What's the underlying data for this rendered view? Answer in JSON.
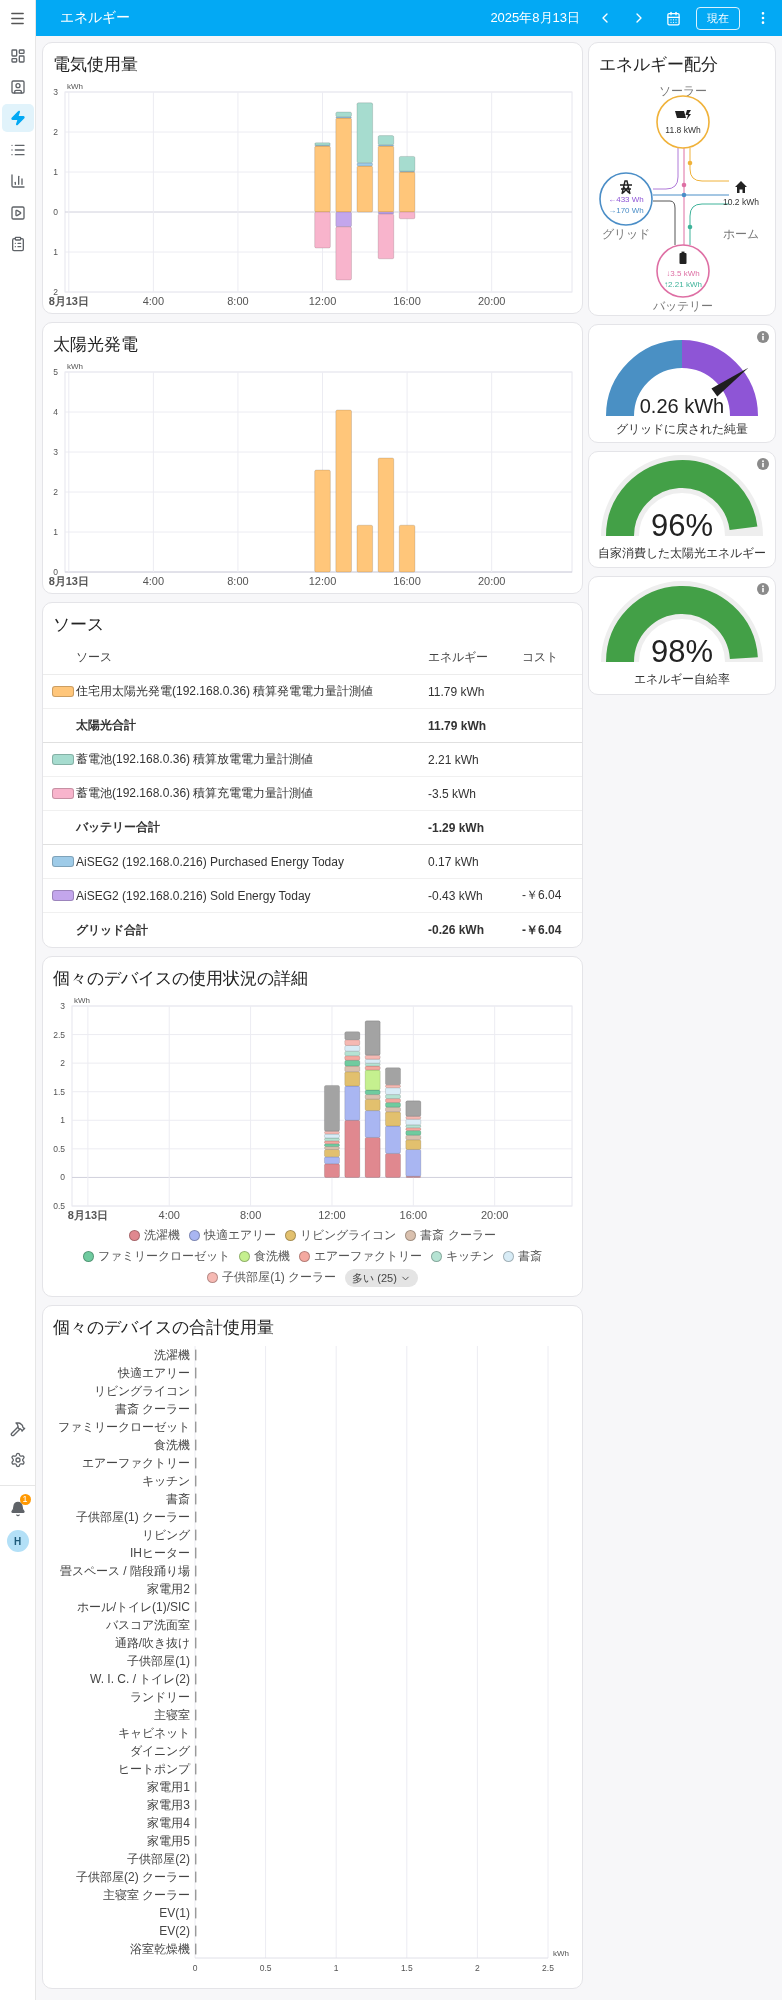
{
  "sidebar": {
    "items": [
      {
        "selected": false
      },
      {
        "selected": false
      },
      {
        "selected": true
      },
      {
        "selected": false
      },
      {
        "selected": false
      },
      {
        "selected": false
      },
      {
        "selected": false
      }
    ],
    "notification_badge": "1",
    "avatar": "H"
  },
  "top_bar": {
    "title": "エネルギー",
    "date": "2025年8月13日",
    "now_button": "現在"
  },
  "electricity_usage": {
    "title": "電気使用量",
    "chart_data": {
      "type": "bar",
      "grid": true,
      "stacked": true,
      "ylabel": "kWh",
      "x": [
        12,
        13,
        14,
        15,
        16
      ],
      "xlim": [
        -0.18,
        23.8
      ],
      "ylim": [
        -2,
        3
      ],
      "xticks": [
        {
          "value": 0,
          "label": "8月13日"
        },
        {
          "value": 4,
          "label": "4:00"
        },
        {
          "value": 8,
          "label": "8:00"
        },
        {
          "value": 12,
          "label": "12:00"
        },
        {
          "value": 16,
          "label": "16:00"
        },
        {
          "value": 20,
          "label": "20:00"
        }
      ],
      "yticks": [
        {
          "value": -2,
          "label": "2"
        },
        {
          "value": -1,
          "label": "1"
        },
        0,
        1,
        2,
        3
      ],
      "series": [
        {
          "color": "#ffc67a",
          "values": [
            1.65,
            2.35,
            1.15,
            1.65,
            1.0
          ]
        },
        {
          "color": "#9ecbe8",
          "values": [
            0.02,
            0.03,
            0.08,
            0.03,
            0.02
          ]
        },
        {
          "color": "#a6dccf",
          "values": [
            0.06,
            0.12,
            1.5,
            0.23,
            0.37
          ]
        },
        {
          "color": "#c3a6ec",
          "values": [
            null,
            -0.37,
            0,
            -0.05,
            0
          ]
        },
        {
          "color": "#f8b4cc",
          "values": [
            -0.9,
            -1.33,
            0,
            -1.12,
            -0.17
          ]
        }
      ]
    }
  },
  "solar_production": {
    "title": "太陽光発電",
    "chart_data": {
      "type": "bar",
      "grid": true,
      "ylabel": "kWh",
      "x": [
        12,
        13,
        14,
        15,
        16
      ],
      "xlim": [
        -0.18,
        23.8
      ],
      "ylim": [
        0,
        5
      ],
      "xticks": [
        {
          "value": 0,
          "label": "8月13日"
        },
        {
          "value": 4,
          "label": "4:00"
        },
        {
          "value": 8,
          "label": "8:00"
        },
        {
          "value": 12,
          "label": "12:00"
        },
        {
          "value": 16,
          "label": "16:00"
        },
        {
          "value": 20,
          "label": "20:00"
        }
      ],
      "yticks": [
        0,
        1,
        2,
        3,
        4,
        5
      ],
      "series": [
        {
          "color": "#ffc67a",
          "values": [
            2.55,
            4.05,
            1.17,
            2.85,
            1.17
          ]
        }
      ]
    }
  },
  "sources": {
    "title": "ソース",
    "columns": [
      "ソース",
      "エネルギー",
      "コスト"
    ],
    "rows": [
      {
        "kind": "source",
        "color": "#ffc67a",
        "name": "住宅用太陽光発電(192.168.0.36) 積算発電電力量計測値",
        "energy": "11.79 kWh"
      },
      {
        "kind": "total",
        "name": "太陽光合計",
        "energy": "11.79 kWh"
      },
      {
        "kind": "source",
        "color": "#a6dccf",
        "name": "蓄電池(192.168.0.36) 積算放電電力量計測値",
        "energy": "2.21 kWh"
      },
      {
        "kind": "source",
        "color": "#f8b4cc",
        "name": "蓄電池(192.168.0.36) 積算充電電力量計測値",
        "energy": "-3.5 kWh"
      },
      {
        "kind": "total",
        "name": "バッテリー合計",
        "energy": "-1.29 kWh"
      },
      {
        "kind": "source",
        "color": "#9ecbe8",
        "name": "AiSEG2 (192.168.0.216) Purchased Energy Today",
        "energy": "0.17 kWh"
      },
      {
        "kind": "source",
        "color": "#c3a6ec",
        "name": "AiSEG2 (192.168.0.216) Sold Energy Today",
        "energy": "-0.43 kWh",
        "cost": "-￥6.04"
      },
      {
        "kind": "total",
        "name": "グリッド合計",
        "energy": "-0.26 kWh",
        "cost": "-￥6.04"
      }
    ]
  },
  "device_usage_detail": {
    "title": "個々のデバイスの使用状況の詳細",
    "more_button": "多い (25)",
    "chart_data": {
      "type": "bar",
      "grid": true,
      "stacked": true,
      "ylabel": "kWh",
      "x": [
        12,
        13,
        14,
        15,
        16
      ],
      "xlim": [
        -0.78,
        23.8
      ],
      "ylim": [
        -0.5,
        3
      ],
      "xticks": [
        {
          "value": 0,
          "label": "8月13日"
        },
        {
          "value": 4,
          "label": "4:00"
        },
        {
          "value": 8,
          "label": "8:00"
        },
        {
          "value": 12,
          "label": "12:00"
        },
        {
          "value": 16,
          "label": "16:00"
        },
        {
          "value": 20,
          "label": "20:00"
        }
      ],
      "yticks": [
        {
          "value": -0.5,
          "label": "0.5"
        },
        0,
        0.5,
        1,
        1.5,
        2,
        2.5,
        3
      ],
      "series": [
        {
          "name": "洗濯機",
          "color": "#e0888f",
          "values": [
            0.24,
            1.0,
            0.7,
            0.42,
            0.02
          ]
        },
        {
          "name": "快適エアリー",
          "color": "#a9b6f2",
          "values": [
            0.12,
            0.6,
            0.47,
            0.48,
            0.47
          ]
        },
        {
          "name": "リビングライコン",
          "color": "#e2c06e",
          "values": [
            0.13,
            0.25,
            0.2,
            0.25,
            0.17
          ]
        },
        {
          "name": "書斎 クーラー",
          "color": "#d9c0ae",
          "values": [
            0.05,
            0.1,
            0.08,
            0.08,
            0.08
          ]
        },
        {
          "name": "ファミリークローゼット",
          "color": "#6fcb9f",
          "values": [
            0.05,
            0.1,
            0.08,
            0.08,
            0.08
          ]
        },
        {
          "name": "食洗機",
          "color": "#c5f08f",
          "values": [
            0,
            0,
            0.35,
            0,
            0
          ]
        },
        {
          "name": "エアーファクトリー",
          "color": "#f4a9a0",
          "values": [
            0.05,
            0.08,
            0.07,
            0.07,
            0.05
          ]
        },
        {
          "name": "キッチン",
          "color": "#b5e3d3",
          "values": [
            0.05,
            0.08,
            0.05,
            0.07,
            0.05
          ]
        },
        {
          "name": "書斎",
          "color": "#d8ecf6",
          "values": [
            0.07,
            0.1,
            0.07,
            0.12,
            0.1
          ]
        },
        {
          "name": "子供部屋(1) クーラー",
          "color": "#f6b9b3",
          "values": [
            0.05,
            0.1,
            0.07,
            0.05,
            0.05
          ]
        },
        {
          "color": "#a3a3a3",
          "values": [
            0.8,
            0.14,
            0.6,
            0.3,
            0.27
          ]
        }
      ]
    }
  },
  "device_usage_total": {
    "title": "個々のデバイスの合計使用量",
    "chart_data": {
      "type": "bar",
      "grid": true,
      "orientation": "horizontal",
      "xlabel": "kWh",
      "xlim": [
        0,
        2.5
      ],
      "xticks": [
        0,
        0.5,
        1,
        1.5,
        2,
        2.5
      ],
      "categories": [
        "洗濯機",
        "快適エアリー",
        "リビングライコン",
        "書斎 クーラー",
        "ファミリークローゼット",
        "食洗機",
        "エアーファクトリー",
        "キッチン",
        "書斎",
        "子供部屋(1) クーラー",
        "リビング",
        "IHヒーター",
        "畳スペース / 階段踊り場",
        "家電用2",
        "ホール/トイレ(1)/SIC",
        "バスコア洗面室",
        "通路/吹き抜け",
        "子供部屋(1)",
        "W. I. C. / トイレ(2)",
        "ランドリー",
        "主寝室",
        "キャビネット",
        "ダイニング",
        "ヒートポンプ",
        "家電用1",
        "家電用3",
        "家電用4",
        "家電用5",
        "子供部屋(2)",
        "子供部屋(2) クーラー",
        "主寝室 クーラー",
        "EV(1)",
        "EV(2)",
        "浴室乾燥機"
      ],
      "series": [
        {
          "color": "#9a9a9a",
          "values": [
            0.01,
            0.01,
            0.01,
            0.01,
            0.01,
            0.01,
            0.01,
            0.01,
            0.01,
            0.01,
            0.01,
            0.01,
            0.01,
            0.01,
            0.01,
            0.01,
            0.01,
            0.01,
            0.01,
            0.01,
            0.01,
            0.01,
            0.01,
            0.01,
            0.01,
            0.01,
            0.01,
            0.01,
            0.01,
            0.01,
            0.01,
            0.01,
            0.01,
            0.01
          ]
        }
      ]
    }
  },
  "energy_distribution": {
    "title": "エネルギー配分",
    "solar": {
      "label": "ソーラー",
      "value": "11.8 kWh"
    },
    "grid": {
      "label": "グリッド",
      "to_grid": "←433 Wh",
      "from_grid": "→170 Wh"
    },
    "home": {
      "label": "ホーム",
      "value": "10.2 kWh"
    },
    "battery": {
      "label": "バッテリー",
      "charge": "↓3.5 kWh",
      "discharge": "↑2.21 kWh"
    }
  },
  "gauges": [
    {
      "kind": "needle",
      "value": "0.26 kWh",
      "label": "グリッドに戻された純量",
      "level": 0.8
    },
    {
      "kind": "fill",
      "value": "96%",
      "label": "自家消費した太陽光エネルギー",
      "level": 0.96
    },
    {
      "kind": "fill",
      "value": "98%",
      "label": "エネルギー自給率",
      "level": 0.98
    }
  ]
}
